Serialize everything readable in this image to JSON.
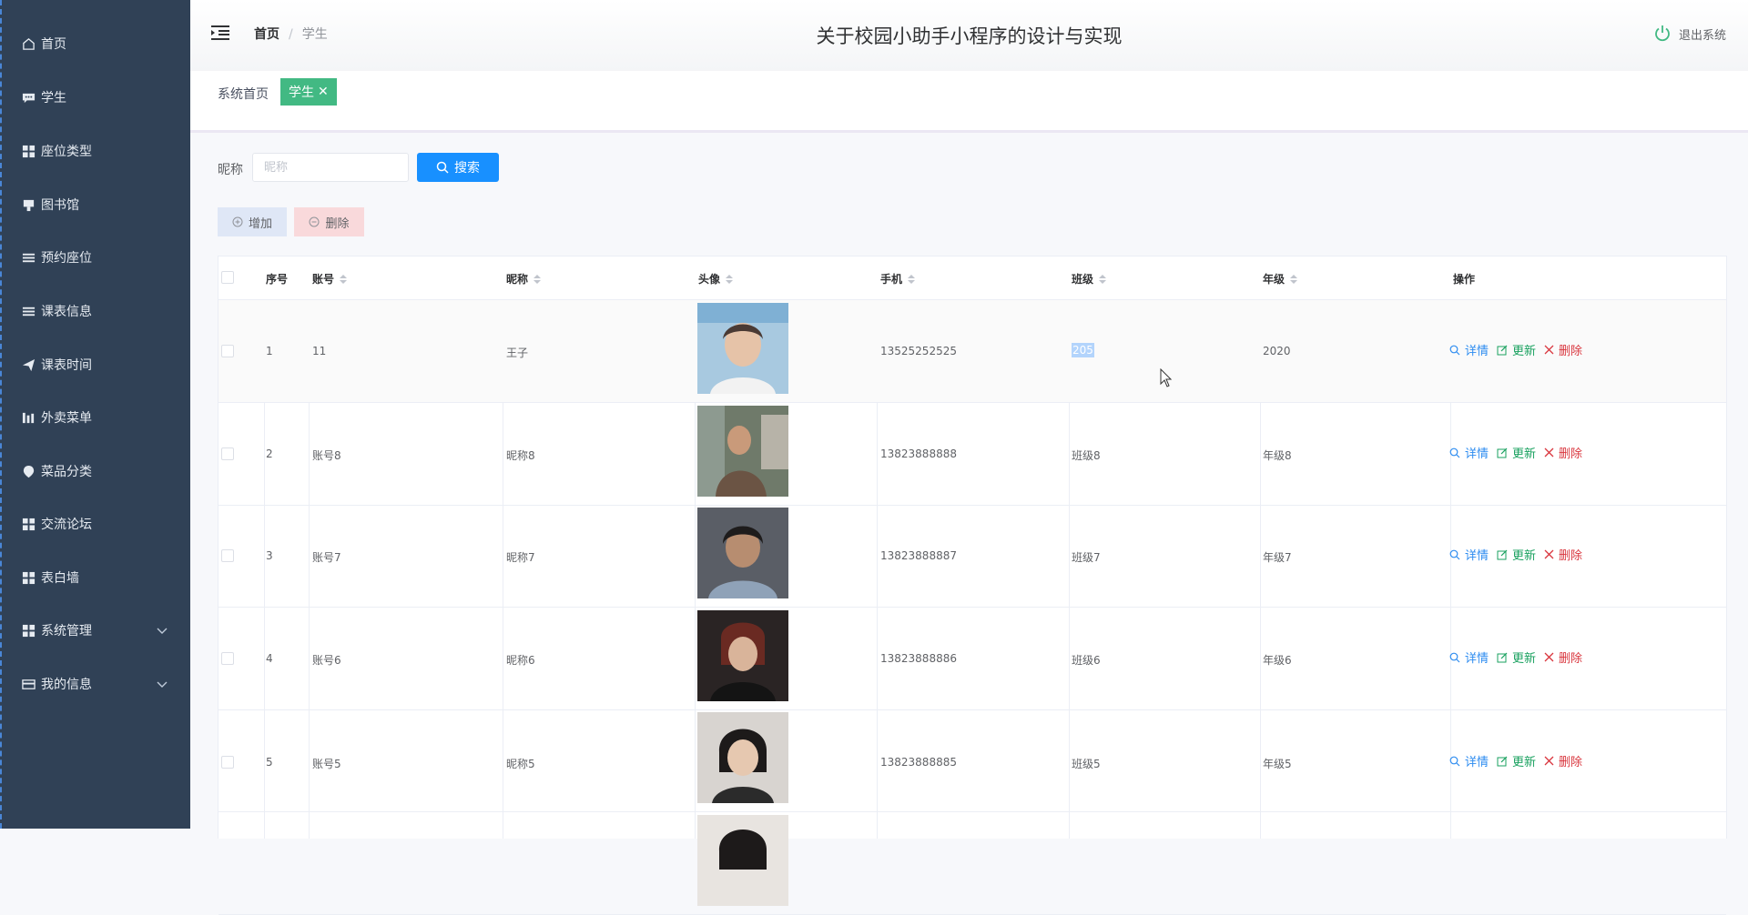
{
  "sidebar": {
    "items": [
      {
        "label": "首页",
        "icon": "home-icon"
      },
      {
        "label": "学生",
        "icon": "chat-icon"
      },
      {
        "label": "座位类型",
        "icon": "grid-icon"
      },
      {
        "label": "图书馆",
        "icon": "building-icon"
      },
      {
        "label": "预约座位",
        "icon": "list-icon"
      },
      {
        "label": "课表信息",
        "icon": "list-icon"
      },
      {
        "label": "课表时间",
        "icon": "paper-plane-icon"
      },
      {
        "label": "外卖菜单",
        "icon": "bar-chart-icon"
      },
      {
        "label": "菜品分类",
        "icon": "location-icon"
      },
      {
        "label": "交流论坛",
        "icon": "grid-icon"
      },
      {
        "label": "表白墙",
        "icon": "grid-icon"
      },
      {
        "label": "系统管理",
        "icon": "grid-icon",
        "expandable": true
      },
      {
        "label": "我的信息",
        "icon": "card-icon",
        "expandable": true
      }
    ]
  },
  "header": {
    "breadcrumb_home": "首页",
    "breadcrumb_sep": "/",
    "breadcrumb_current": "学生",
    "title": "关于校园小助手小程序的设计与实现",
    "logout": "退出系统"
  },
  "tags": {
    "home": "系统首页",
    "active": "学生",
    "close": "✕"
  },
  "search": {
    "label": "昵称",
    "placeholder": "昵称",
    "value": "",
    "button": "搜索"
  },
  "actions": {
    "add": "增加",
    "delete": "删除"
  },
  "table": {
    "columns": [
      "序号",
      "账号",
      "昵称",
      "头像",
      "手机",
      "班级",
      "年级",
      "操作"
    ],
    "op_labels": {
      "detail": "详情",
      "update": "更新",
      "delete": "删除"
    },
    "rows": [
      {
        "index": "1",
        "account": "11",
        "nickname": "王子",
        "phone": "13525252525",
        "class": "205",
        "grade": "2020",
        "class_selected": true
      },
      {
        "index": "2",
        "account": "账号8",
        "nickname": "昵称8",
        "phone": "13823888888",
        "class": "班级8",
        "grade": "年级8"
      },
      {
        "index": "3",
        "account": "账号7",
        "nickname": "昵称7",
        "phone": "13823888887",
        "class": "班级7",
        "grade": "年级7"
      },
      {
        "index": "4",
        "account": "账号6",
        "nickname": "昵称6",
        "phone": "13823888886",
        "class": "班级6",
        "grade": "年级6"
      },
      {
        "index": "5",
        "account": "账号5",
        "nickname": "昵称5",
        "phone": "13823888885",
        "class": "班级5",
        "grade": "年级5"
      }
    ]
  },
  "colors": {
    "sidebar": "#304156",
    "tag_active": "#42b983",
    "primary": "#1890ff",
    "detail": "#2d8cf0",
    "update": "#19a15f",
    "delete": "#d9363e"
  }
}
